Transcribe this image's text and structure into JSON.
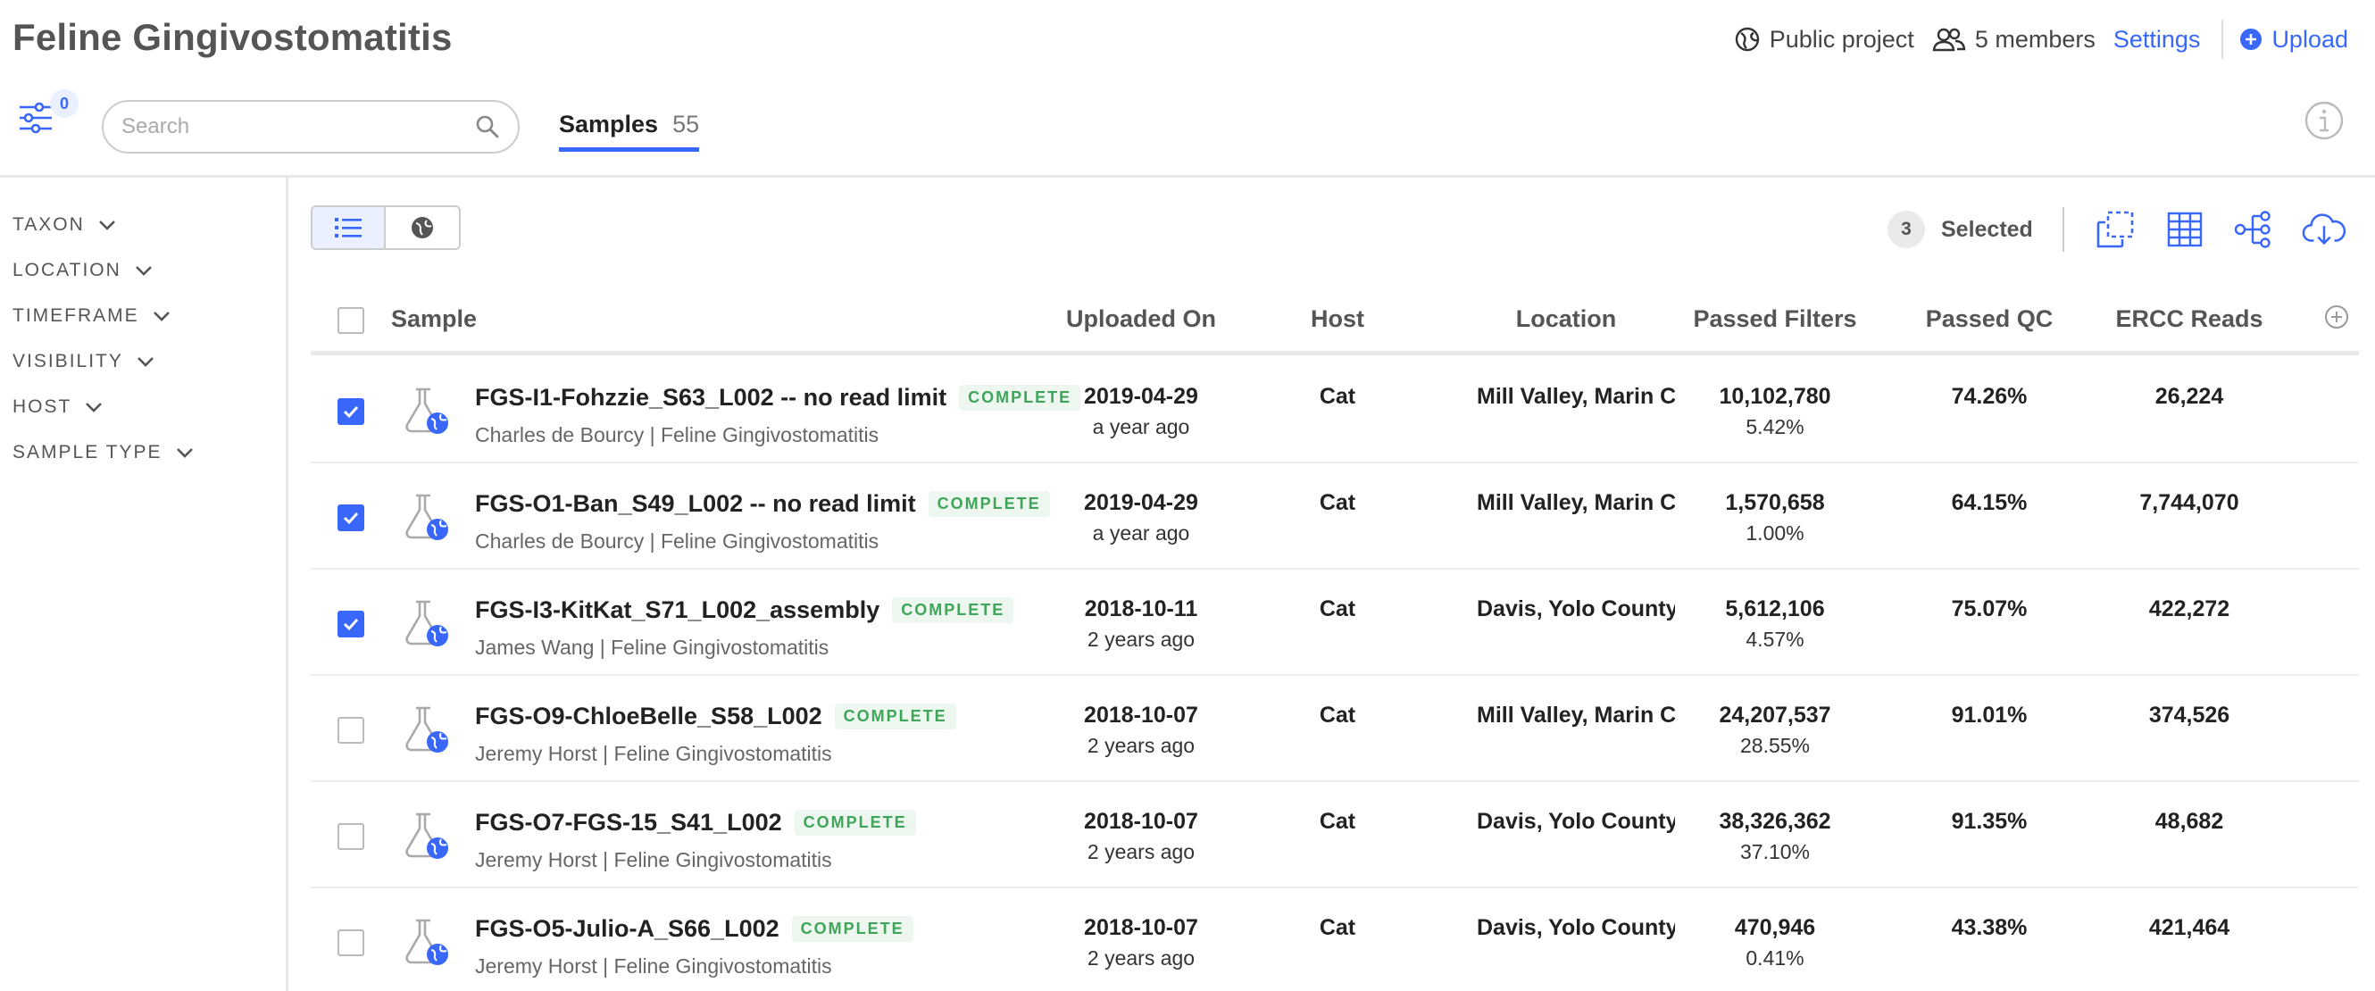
{
  "header": {
    "title": "Feline Gingivostomatitis",
    "visibility": "Public project",
    "members": "5 members",
    "settings": "Settings",
    "upload": "Upload"
  },
  "filters": {
    "count": "0"
  },
  "search": {
    "placeholder": "Search"
  },
  "tabs": [
    {
      "label": "Samples",
      "count": "55"
    }
  ],
  "sidebar": {
    "facets": [
      "TAXON",
      "LOCATION",
      "TIMEFRAME",
      "VISIBILITY",
      "HOST",
      "SAMPLE TYPE"
    ]
  },
  "toolbar": {
    "selected_count": "3",
    "selected_label": "Selected"
  },
  "table": {
    "columns": [
      "Sample",
      "Uploaded On",
      "Host",
      "Location",
      "Passed Filters",
      "Passed QC",
      "ERCC Reads"
    ],
    "rows": [
      {
        "checked": true,
        "name": "FGS-I1-Fohzzie_S63_L002 -- no read limit",
        "status": "COMPLETE",
        "sub": "Charles de Bourcy | Feline Gingivostomatitis",
        "date": "2019-04-29",
        "ago": "a year ago",
        "host": "Cat",
        "location": "Mill Valley, Marin County",
        "passed_filters": "10,102,780",
        "passed_filters_pct": "5.42%",
        "passed_qc": "74.26%",
        "ercc": "26,224"
      },
      {
        "checked": true,
        "name": "FGS-O1-Ban_S49_L002 -- no read limit",
        "status": "COMPLETE",
        "sub": "Charles de Bourcy | Feline Gingivostomatitis",
        "date": "2019-04-29",
        "ago": "a year ago",
        "host": "Cat",
        "location": "Mill Valley, Marin County",
        "passed_filters": "1,570,658",
        "passed_filters_pct": "1.00%",
        "passed_qc": "64.15%",
        "ercc": "7,744,070"
      },
      {
        "checked": true,
        "name": "FGS-I3-KitKat_S71_L002_assembly",
        "status": "COMPLETE",
        "sub": "James Wang | Feline Gingivostomatitis",
        "date": "2018-10-11",
        "ago": "2 years ago",
        "host": "Cat",
        "location": "Davis, Yolo County",
        "passed_filters": "5,612,106",
        "passed_filters_pct": "4.57%",
        "passed_qc": "75.07%",
        "ercc": "422,272"
      },
      {
        "checked": false,
        "name": "FGS-O9-ChloeBelle_S58_L002",
        "status": "COMPLETE",
        "sub": "Jeremy Horst | Feline Gingivostomatitis",
        "date": "2018-10-07",
        "ago": "2 years ago",
        "host": "Cat",
        "location": "Mill Valley, Marin County",
        "passed_filters": "24,207,537",
        "passed_filters_pct": "28.55%",
        "passed_qc": "91.01%",
        "ercc": "374,526"
      },
      {
        "checked": false,
        "name": "FGS-O7-FGS-15_S41_L002",
        "status": "COMPLETE",
        "sub": "Jeremy Horst | Feline Gingivostomatitis",
        "date": "2018-10-07",
        "ago": "2 years ago",
        "host": "Cat",
        "location": "Davis, Yolo County",
        "passed_filters": "38,326,362",
        "passed_filters_pct": "37.10%",
        "passed_qc": "91.35%",
        "ercc": "48,682"
      },
      {
        "checked": false,
        "name": "FGS-O5-Julio-A_S66_L002",
        "status": "COMPLETE",
        "sub": "Jeremy Horst | Feline Gingivostomatitis",
        "date": "2018-10-07",
        "ago": "2 years ago",
        "host": "Cat",
        "location": "Davis, Yolo County",
        "passed_filters": "470,946",
        "passed_filters_pct": "0.41%",
        "passed_qc": "43.38%",
        "ercc": "421,464"
      }
    ]
  },
  "colors": {
    "accent": "#3867fa",
    "complete": "#3fa55b"
  },
  "icons": [
    "filter-icon",
    "search-icon",
    "globe-icon",
    "members-icon",
    "upload-icon",
    "info-icon",
    "list-view-icon",
    "map-view-icon",
    "bulk-select-icon",
    "heatmap-icon",
    "phylo-tree-icon",
    "download-icon",
    "flask-icon",
    "add-column-icon"
  ]
}
